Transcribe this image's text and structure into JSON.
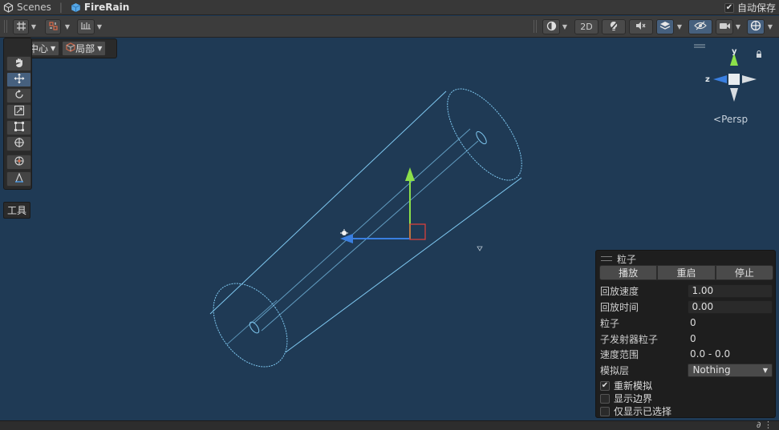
{
  "breadcrumb": {
    "scenes_label": "Scenes",
    "prefab_label": "FireRain"
  },
  "autosave": {
    "label": "自动保存",
    "checked": true
  },
  "toolbar": {
    "mode_2d_label": "2D"
  },
  "pivot": {
    "center_label": "中心",
    "local_label": "局部"
  },
  "tools_overlay_label": "工具",
  "orientation_gizmo": {
    "y_label": "y",
    "z_label": "z",
    "projection_label": "Persp"
  },
  "particle_panel": {
    "title": "粒子",
    "buttons": {
      "play": "播放",
      "restart": "重启",
      "stop": "停止"
    },
    "fields": {
      "playback_speed_label": "回放速度",
      "playback_speed_value": "1.00",
      "playback_time_label": "回放时间",
      "playback_time_value": "0.00",
      "particles_label": "粒子",
      "particles_value": "0",
      "sub_emitter_label": "子发射器粒子",
      "sub_emitter_value": "0",
      "speed_range_label": "速度范围",
      "speed_range_value": "0.0 - 0.0",
      "simulation_layers_label": "模拟层",
      "simulation_layers_value": "Nothing"
    },
    "checks": {
      "resimulate_label": "重新模拟",
      "resimulate_checked": true,
      "show_bounds_label": "显示边界",
      "show_bounds_checked": false,
      "show_selected_only_label": "仅显示已选择",
      "show_selected_only_checked": false
    }
  },
  "colors": {
    "scene_background": "#1f3a55",
    "shape_wire": "#7fc8f0",
    "gizmo_y": "#8ce04a",
    "gizmo_x": "#d8403c",
    "gizmo_z": "#3a7fe0",
    "tool_active": "#46607e"
  }
}
